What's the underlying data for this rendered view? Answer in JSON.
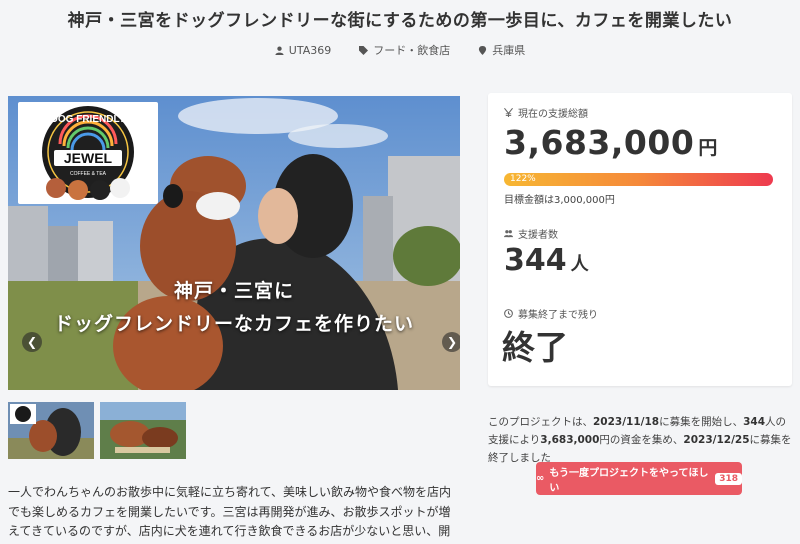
{
  "page": {
    "title": "神戸・三宮をドッグフレンドリーな街にするための第一歩目に、カフェを開業したい"
  },
  "meta": {
    "author": "UTA369",
    "category": "フード・飲食店",
    "location": "兵庫県"
  },
  "hero": {
    "logo_line1": "DOG FRIENDLY",
    "logo_line2": "JEWEL",
    "logo_line3": "COFFEE & TEA",
    "caption_line1": "神戸・三宮に",
    "caption_line2": "ドッグフレンドリーなカフェを作りたい",
    "prev_icon": "chevron-left-icon",
    "next_icon": "chevron-right-icon"
  },
  "thumbnails": [
    {
      "alt": "thumbnail-1"
    },
    {
      "alt": "thumbnail-2"
    }
  ],
  "description": "一人でわんちゃんのお散歩中に気軽に立ち寄れて、美味しい飲み物や食べ物を店内でも楽しめるカフェを開業したいです。三宮は再開発が進み、お散歩スポットが増えてきているのですが、店内に犬を連れて行き飲食できるお店が少ないと思い、開業を志しました。",
  "stats": {
    "total_label": "現在の支援総額",
    "total_value": "3,683,000",
    "total_unit": "円",
    "progress_text": "122%",
    "progress_percent": 122,
    "goal_text": "目標金額は3,000,000円",
    "supporters_label": "支援者数",
    "supporters_value": "344",
    "supporters_unit": "人",
    "remaining_label": "募集終了まで残り",
    "remaining_value": "終了"
  },
  "summary": {
    "p1": "このプロジェクトは、",
    "start_date": "2023/11/18",
    "p2": "に募集を開始し、",
    "supporters": "344",
    "p3": "人の支援により",
    "amount": "3,683,000",
    "p4": "円の資金を集め、",
    "end_date": "2023/12/25",
    "p5": "に募集を終了しました"
  },
  "cta": {
    "label": "もう一度プロジェクトをやってほしい",
    "count": "318"
  },
  "colors": {
    "accent": "#ea5a64",
    "progress_start": "#f7b733",
    "progress_end": "#ee3a4f"
  }
}
